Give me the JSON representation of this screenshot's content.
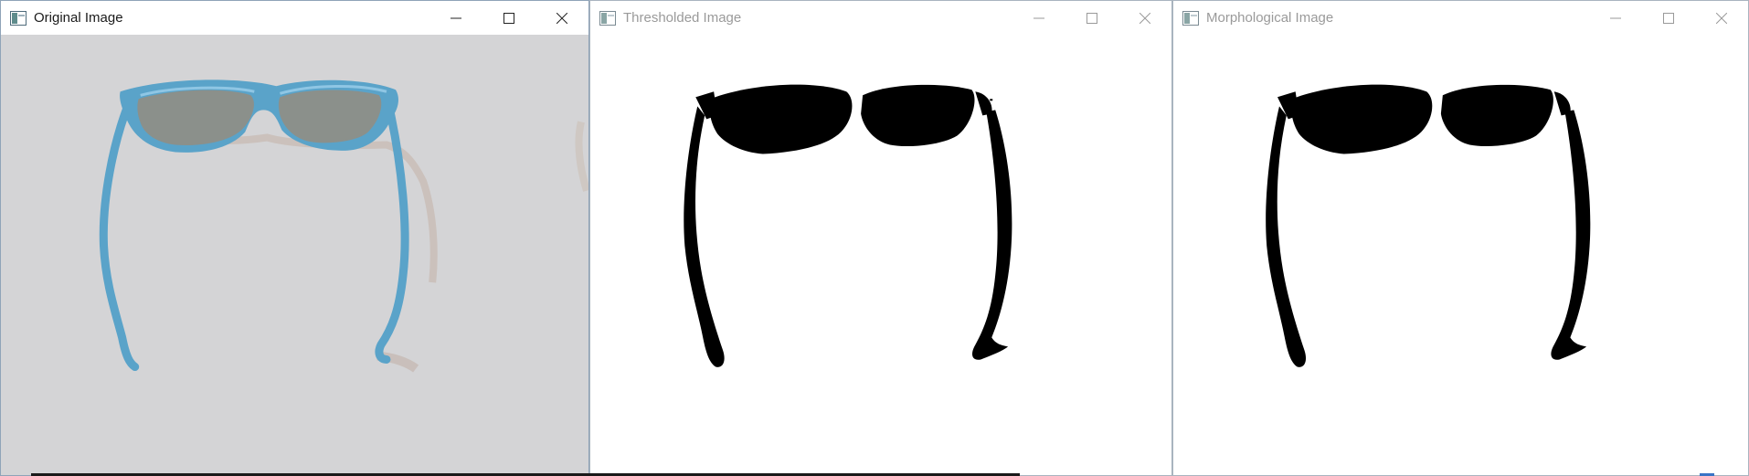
{
  "windows": [
    {
      "title": "Original Image",
      "state": "active",
      "image_content": "blue sunglasses on grey background",
      "controls": [
        "minimize-icon",
        "maximize-icon",
        "close-icon"
      ]
    },
    {
      "title": "Thresholded Image",
      "state": "inactive",
      "image_content": "binary threshold mask of sunglasses",
      "controls": [
        "minimize-icon",
        "maximize-icon",
        "close-icon"
      ]
    },
    {
      "title": "Morphological Image",
      "state": "inactive",
      "image_content": "morphologically cleaned mask of sunglasses",
      "controls": [
        "minimize-icon",
        "maximize-icon",
        "close-icon"
      ]
    }
  ],
  "colors": {
    "background": "#cfd6df",
    "original_bg": "#d4d4d6",
    "frame_blue": "#5aa3c9",
    "lens_grey": "#8b908b",
    "mask": "#000000"
  }
}
